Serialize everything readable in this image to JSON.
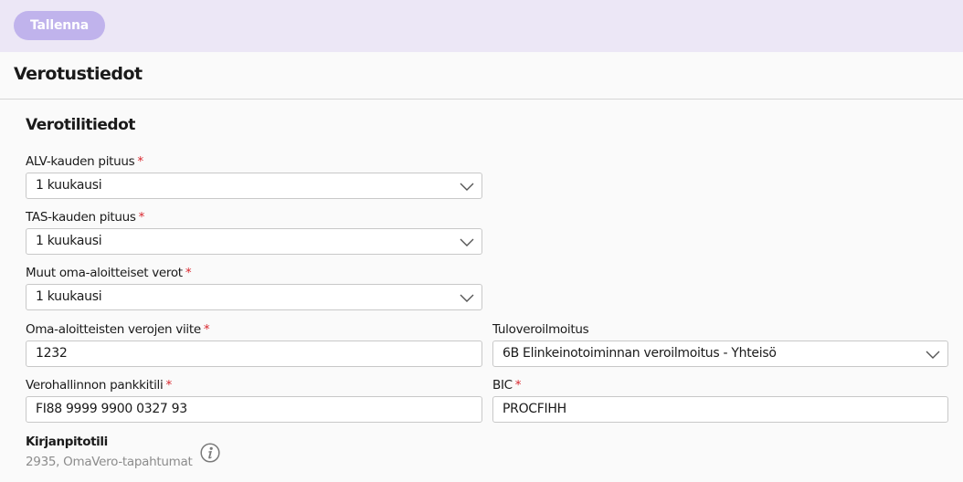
{
  "toolbar": {
    "save_label": "Tallenna"
  },
  "page": {
    "title": "Verotustiedot"
  },
  "section": {
    "title": "Verotilitiedot"
  },
  "fields": {
    "alv": {
      "label": "ALV-kauden pituus",
      "required": "*",
      "value": "1 kuukausi"
    },
    "tas": {
      "label": "TAS-kauden pituus",
      "required": "*",
      "value": "1 kuukausi"
    },
    "muut": {
      "label": "Muut oma-aloitteiset verot",
      "required": "*",
      "value": "1 kuukausi"
    },
    "viite": {
      "label": "Oma-aloitteisten verojen viite",
      "required": "*",
      "value": "1232"
    },
    "tuloveroilmoitus": {
      "label": "Tuloveroilmoitus",
      "value": "6B Elinkeinotoiminnan veroilmoitus - Yhteisö"
    },
    "pankkitili": {
      "label": "Verohallinnon pankkitili",
      "required": "*",
      "value": "FI88 9999 9900 0327 93"
    },
    "bic": {
      "label": "BIC",
      "required": "*",
      "value": "PROCFIHH"
    }
  },
  "kirjanpitotili": {
    "label": "Kirjanpitotili",
    "value": "2935, OmaVero-tapahtumat"
  },
  "icons": {
    "dropdown": "chevron-down-icon",
    "info": "info-icon"
  },
  "colors": {
    "topbar_bg": "#ece7f6",
    "save_button_bg": "#c0b3ec",
    "required_mark": "#d9272e"
  }
}
